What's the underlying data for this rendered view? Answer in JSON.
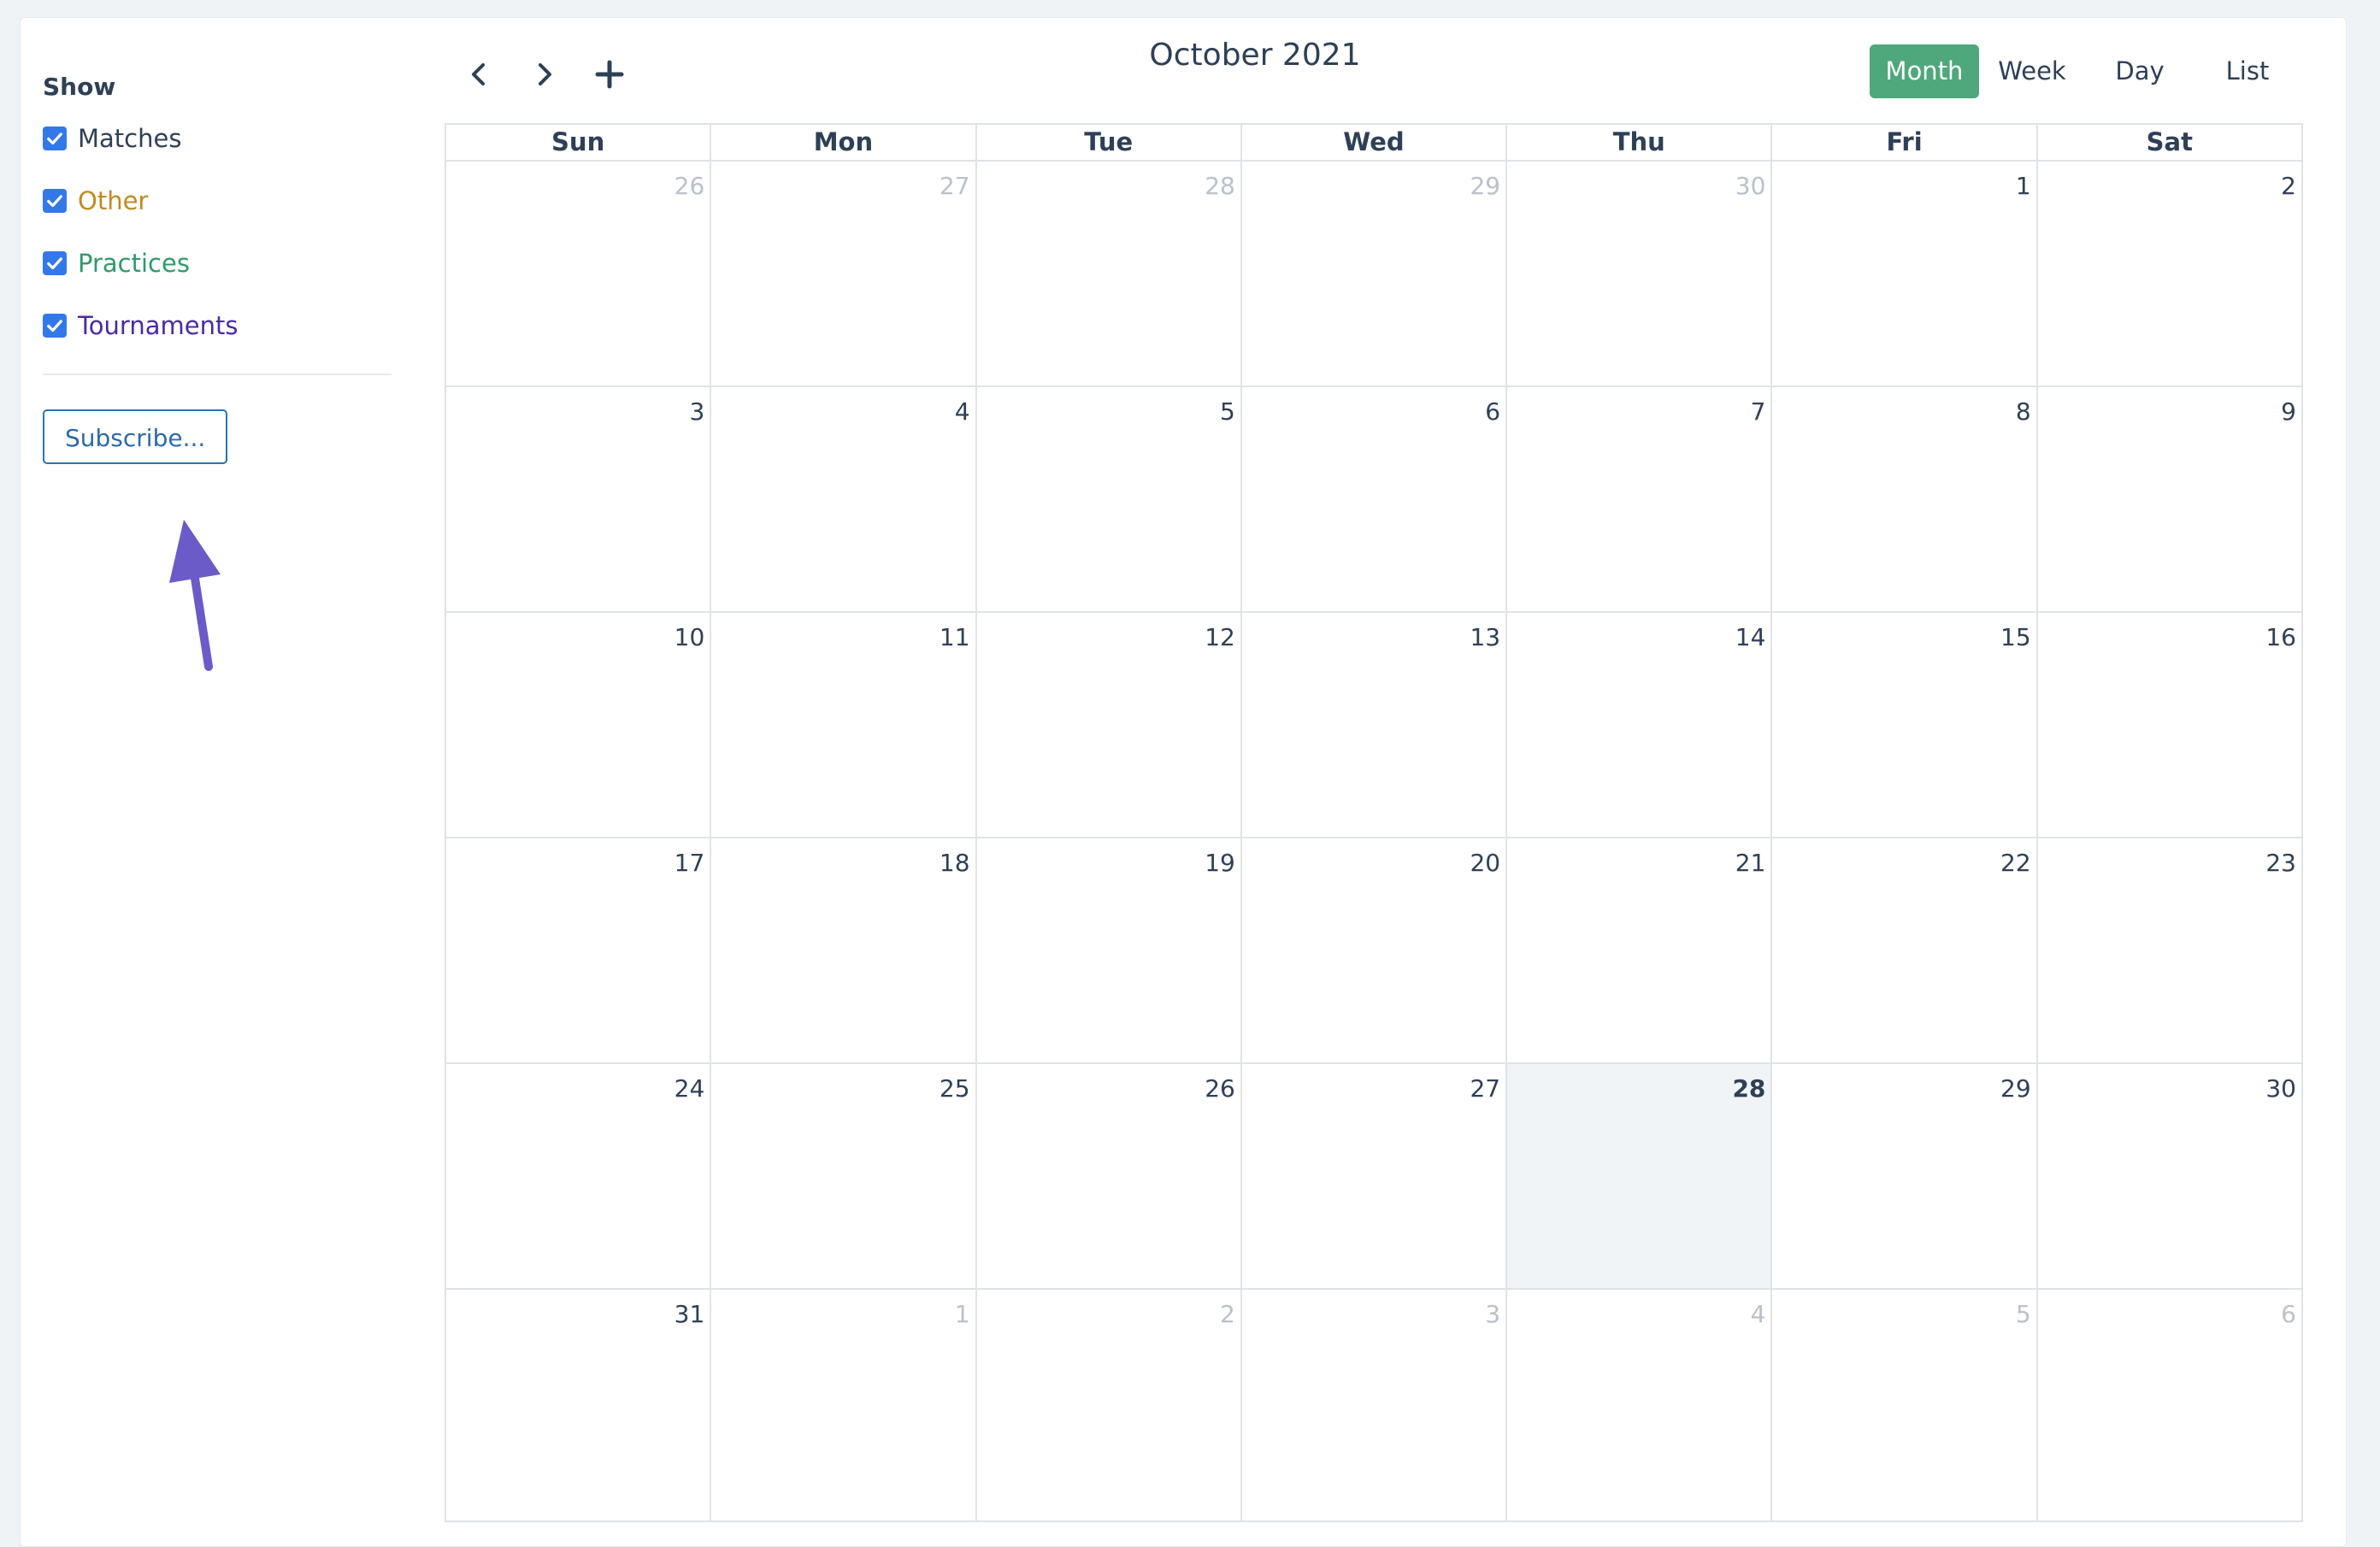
{
  "sidebar": {
    "show_label": "Show",
    "filters": [
      {
        "label": "Matches",
        "color": "#2d4057",
        "checked": true
      },
      {
        "label": "Other",
        "color": "#c28a1f",
        "checked": true
      },
      {
        "label": "Practices",
        "color": "#2e9a6b",
        "checked": true
      },
      {
        "label": "Tournaments",
        "color": "#4a2aa8",
        "checked": true
      }
    ],
    "subscribe_label": "Subscribe..."
  },
  "toolbar": {
    "title": "October 2021",
    "prev_icon": "chevron-left-icon",
    "next_icon": "chevron-right-icon",
    "add_icon": "plus-icon",
    "views": [
      {
        "label": "Month",
        "active": true
      },
      {
        "label": "Week",
        "active": false
      },
      {
        "label": "Day",
        "active": false
      },
      {
        "label": "List",
        "active": false
      }
    ]
  },
  "calendar": {
    "weekdays": [
      "Sun",
      "Mon",
      "Tue",
      "Wed",
      "Thu",
      "Fri",
      "Sat"
    ],
    "weeks": [
      [
        {
          "d": "26",
          "other": true
        },
        {
          "d": "27",
          "other": true
        },
        {
          "d": "28",
          "other": true
        },
        {
          "d": "29",
          "other": true
        },
        {
          "d": "30",
          "other": true
        },
        {
          "d": "1"
        },
        {
          "d": "2"
        }
      ],
      [
        {
          "d": "3"
        },
        {
          "d": "4"
        },
        {
          "d": "5"
        },
        {
          "d": "6"
        },
        {
          "d": "7"
        },
        {
          "d": "8"
        },
        {
          "d": "9"
        }
      ],
      [
        {
          "d": "10"
        },
        {
          "d": "11"
        },
        {
          "d": "12"
        },
        {
          "d": "13"
        },
        {
          "d": "14"
        },
        {
          "d": "15"
        },
        {
          "d": "16"
        }
      ],
      [
        {
          "d": "17"
        },
        {
          "d": "18"
        },
        {
          "d": "19"
        },
        {
          "d": "20"
        },
        {
          "d": "21"
        },
        {
          "d": "22"
        },
        {
          "d": "23"
        }
      ],
      [
        {
          "d": "24"
        },
        {
          "d": "25"
        },
        {
          "d": "26"
        },
        {
          "d": "27"
        },
        {
          "d": "28",
          "today": true
        },
        {
          "d": "29"
        },
        {
          "d": "30"
        }
      ],
      [
        {
          "d": "31"
        },
        {
          "d": "1",
          "other": true
        },
        {
          "d": "2",
          "other": true
        },
        {
          "d": "3",
          "other": true
        },
        {
          "d": "4",
          "other": true
        },
        {
          "d": "5",
          "other": true
        },
        {
          "d": "6",
          "other": true
        }
      ]
    ]
  },
  "colors": {
    "accent": "#4fa77c",
    "checkbox": "#3378e8",
    "arrow": "#6b5bc9"
  }
}
